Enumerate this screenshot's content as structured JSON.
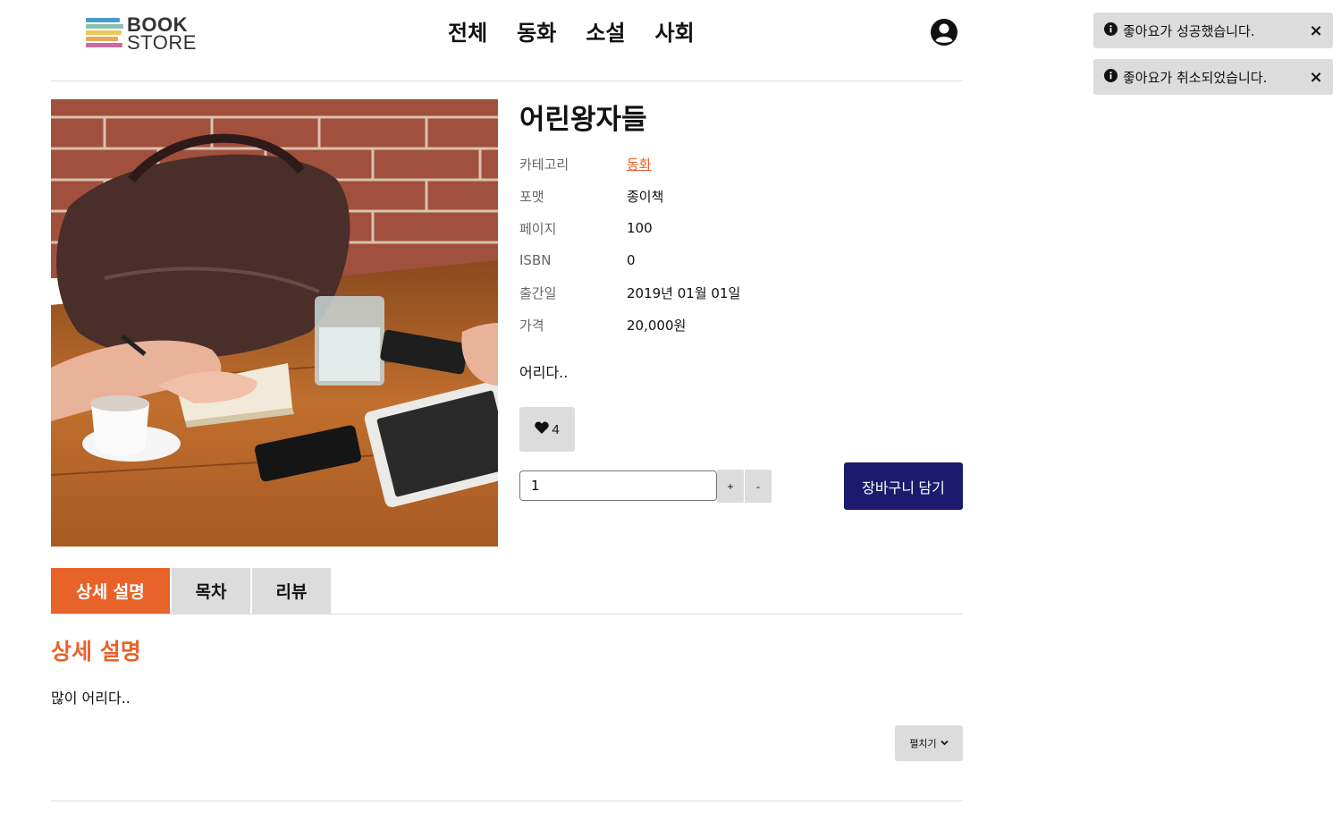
{
  "header": {
    "logo": {
      "line1": "BOOK",
      "line2": "STORE",
      "stripe_colors": [
        "#4a9ac8",
        "#88c3b0",
        "#e8c95a",
        "#e8a85a",
        "#c96aa0",
        "#7a3a6a"
      ]
    },
    "nav": [
      {
        "label": "전체"
      },
      {
        "label": "동화"
      },
      {
        "label": "소설"
      },
      {
        "label": "사회"
      }
    ],
    "user_icon": "user-circle-icon"
  },
  "book": {
    "title": "어린왕자들",
    "details": [
      {
        "key": "카테고리",
        "value": "동화",
        "is_link": true
      },
      {
        "key": "포맷",
        "value": "종이책"
      },
      {
        "key": "페이지",
        "value": "100"
      },
      {
        "key": "ISBN",
        "value": "0"
      },
      {
        "key": "출간일",
        "value": "2019년 01월 01일"
      },
      {
        "key": "가격",
        "value": "20,000원"
      }
    ],
    "summary": "어리다..",
    "likes": "4",
    "quantity": "1",
    "plus_label": "+",
    "minus_label": "-",
    "cart_label": "장바구니 담기"
  },
  "tabs": [
    {
      "label": "상세 설명",
      "active": true
    },
    {
      "label": "목차",
      "active": false
    },
    {
      "label": "리뷰",
      "active": false
    }
  ],
  "detail_section": {
    "title": "상세 설명",
    "text": "많이 어리다..",
    "expand_label": "펼치기"
  },
  "toasts": [
    {
      "message": "좋아요가 성공했습니다.",
      "close": "×"
    },
    {
      "message": "좋아요가 취소되었습니다.",
      "close": "×"
    }
  ],
  "colors": {
    "accent": "#e8632a",
    "cart_button": "#1b1a6e",
    "neutral_button": "#dcdcdc"
  }
}
